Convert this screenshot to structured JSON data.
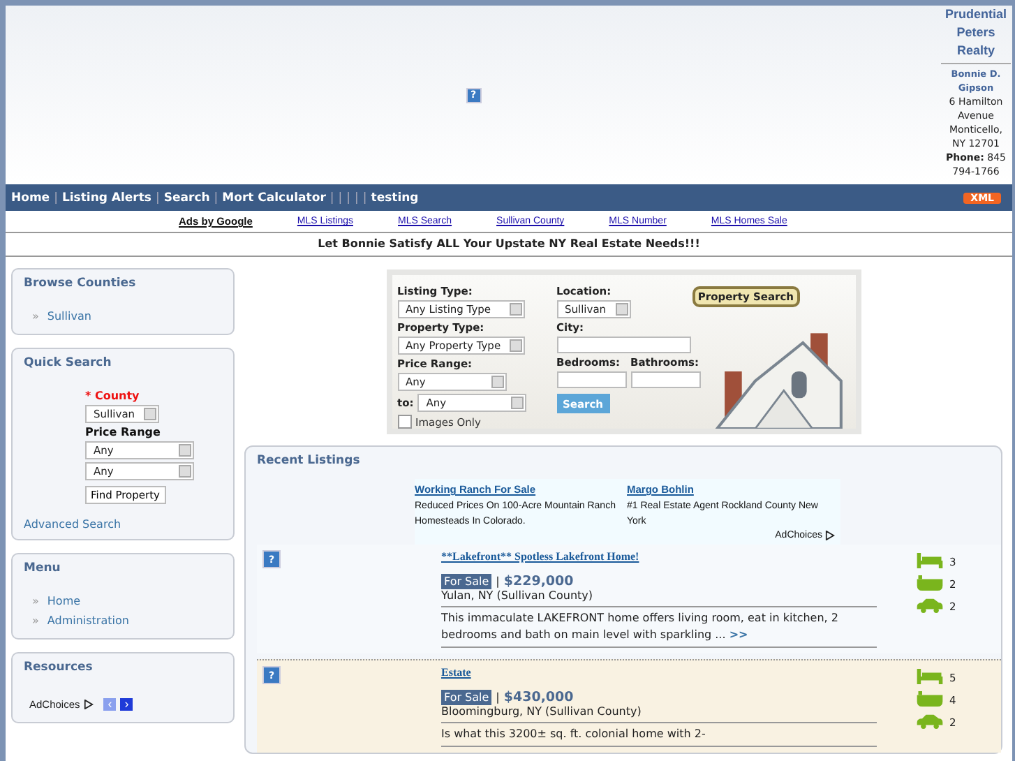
{
  "banner": {
    "image_icon": "?"
  },
  "agent": {
    "company": [
      "Prudential",
      "Peters",
      "Realty"
    ],
    "name": "Bonnie D. Gipson",
    "address": [
      "6 Hamilton",
      "Avenue",
      "Monticello,",
      "NY 12701"
    ],
    "phone_label": "Phone:",
    "phone": "845 794-1766"
  },
  "nav": {
    "items": [
      {
        "kind": "link",
        "text": "Home"
      },
      {
        "kind": "separator",
        "text": "|"
      },
      {
        "kind": "link",
        "text": "Listing Alerts"
      },
      {
        "kind": "separator",
        "text": "|"
      },
      {
        "kind": "link",
        "text": "Search"
      },
      {
        "kind": "separator",
        "text": "|"
      },
      {
        "kind": "link",
        "text": "Mort Calculator"
      },
      {
        "kind": "separator",
        "text": "|"
      },
      {
        "kind": "separator",
        "text": "|"
      },
      {
        "kind": "separator",
        "text": "|"
      },
      {
        "kind": "separator",
        "text": "|"
      },
      {
        "kind": "separator",
        "text": "|"
      },
      {
        "kind": "link",
        "text": "testing"
      }
    ],
    "feed": "XML"
  },
  "ad_links": {
    "label": "Ads by Google",
    "links": [
      "MLS Listings",
      "MLS Search",
      "Sullivan County",
      "MLS Number",
      "MLS Homes Sale"
    ]
  },
  "tagline": "Let Bonnie Satisfy ALL Your Upstate NY Real Estate Needs!!!",
  "sidebar": [
    {
      "kind": "links",
      "title": "Browse Counties",
      "bullet": "»",
      "items": [
        "Sullivan"
      ]
    },
    {
      "kind": "quick_search",
      "title": "Quick Search",
      "required_mark": "*",
      "county_label": "County",
      "county": "Sullivan",
      "price_label": "Price Range",
      "price_from": "Any",
      "price_to": "Any",
      "button": "Find Property",
      "advanced": "Advanced Search"
    },
    {
      "kind": "links",
      "title": "Menu",
      "bullet": "»",
      "items": [
        "Home",
        "Administration"
      ]
    },
    {
      "kind": "ad",
      "title": "Resources",
      "adchoices": "AdChoices",
      "prev": "‹",
      "next": "›"
    }
  ],
  "property_search": {
    "badge": "Property Search",
    "listing_type_label": "Listing Type:",
    "listing_type": "Any Listing Type",
    "property_type_label": "Property Type:",
    "property_type": "Any Property Type",
    "price_label": "Price Range:",
    "price_from": "Any",
    "to_label": "to:",
    "price_to": "Any",
    "images_only_label": "Images Only",
    "images_only": false,
    "location_label": "Location:",
    "location": "Sullivan",
    "city_label": "City:",
    "bedrooms_label": "Bedrooms:",
    "bathrooms_label": "Bathrooms:",
    "button": "Search"
  },
  "recent": {
    "title": "Recent Listings",
    "ads": [
      {
        "title": "Working Ranch For Sale",
        "text": "Reduced Prices On 100-Acre Mountain Ranch Homesteads In Colorado."
      },
      {
        "title": "Margo Bohlin",
        "text": "#1 Real Estate Agent Rockland County New York"
      }
    ],
    "adchoices": "AdChoices",
    "listings": [
      {
        "featured": false,
        "image_icon": "?",
        "title": "**Lakefront** Spotless Lakefront Home!",
        "status": "For Sale",
        "separator": "|",
        "price": "$229,000",
        "location": "Yulan, NY (Sullivan County)",
        "description": "This immaculate LAKEFRONT home offers living room, eat in kitchen, 2 bedrooms and bath on main level with sparkling ...",
        "more": ">>",
        "beds": "3",
        "baths": "2",
        "garage": "2"
      },
      {
        "featured": true,
        "image_icon": "?",
        "title": "Estate",
        "status": "For Sale",
        "separator": "|",
        "price": "$430,000",
        "location": "Bloomingburg, NY (Sullivan County)",
        "description": "Is what this 3200± sq. ft. colonial home with 2-",
        "beds": "5",
        "baths": "4",
        "garage": "2"
      }
    ]
  }
}
